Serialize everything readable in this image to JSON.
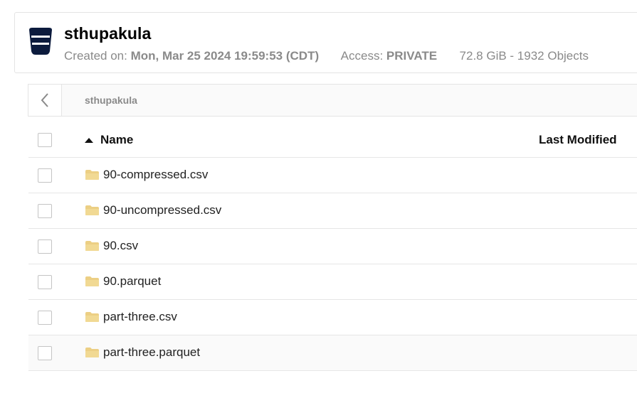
{
  "bucket": {
    "name": "sthupakula",
    "created_label": "Created on:",
    "created_value": "Mon, Mar 25 2024 19:59:53 (CDT)",
    "access_label": "Access:",
    "access_value": "PRIVATE",
    "usage": "72.8 GiB - 1932 Objects",
    "icon": "bucket-icon"
  },
  "browser": {
    "back_icon": "chevron-left-icon",
    "breadcrumb": "sthupakula"
  },
  "table": {
    "columns": {
      "name": "Name",
      "last_modified": "Last Modified"
    },
    "rows": [
      {
        "name": "90-compressed.csv",
        "type": "folder"
      },
      {
        "name": "90-uncompressed.csv",
        "type": "folder"
      },
      {
        "name": "90.csv",
        "type": "folder"
      },
      {
        "name": "90.parquet",
        "type": "folder"
      },
      {
        "name": "part-three.csv",
        "type": "folder"
      },
      {
        "name": "part-three.parquet",
        "type": "folder"
      }
    ]
  },
  "colors": {
    "accent": "#0c1b3d",
    "folder": "#eccf84",
    "muted": "#8a8a8a"
  }
}
